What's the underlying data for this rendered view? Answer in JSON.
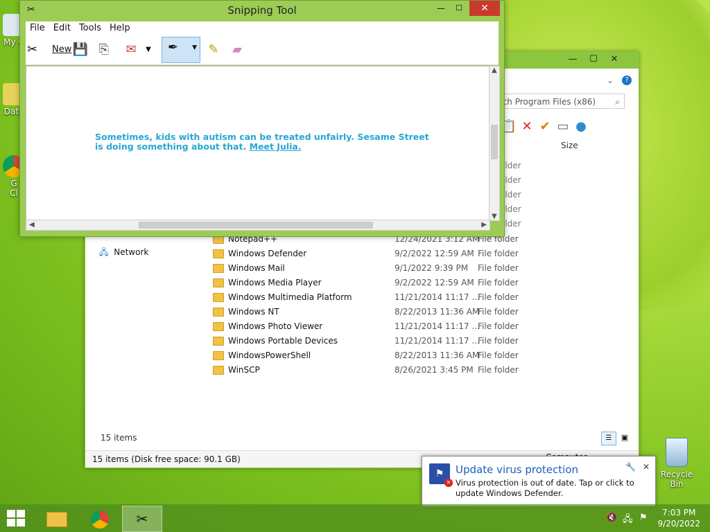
{
  "desktop": {
    "partial_icons": [
      "My C",
      "Data",
      "G",
      "Cl"
    ],
    "recycle_bin_label": "Recycle Bin"
  },
  "explorer": {
    "search_placeholder": "rch Program Files (x86)",
    "col_size": "Size",
    "partial_types": [
      "older",
      "older",
      "older",
      "older",
      "older"
    ],
    "network_label": "Network",
    "rows": [
      {
        "name": "Notepad++",
        "date": "12/24/2021 3:12 AM",
        "type": "File folder"
      },
      {
        "name": "Windows Defender",
        "date": "9/2/2022 12:59 AM",
        "type": "File folder"
      },
      {
        "name": "Windows Mail",
        "date": "9/1/2022 9:39 PM",
        "type": "File folder"
      },
      {
        "name": "Windows Media Player",
        "date": "9/2/2022 12:59 AM",
        "type": "File folder"
      },
      {
        "name": "Windows Multimedia Platform",
        "date": "11/21/2014 11:17 ...",
        "type": "File folder"
      },
      {
        "name": "Windows NT",
        "date": "8/22/2013 11:36 AM",
        "type": "File folder"
      },
      {
        "name": "Windows Photo Viewer",
        "date": "11/21/2014 11:17 ...",
        "type": "File folder"
      },
      {
        "name": "Windows Portable Devices",
        "date": "11/21/2014 11:17 ...",
        "type": "File folder"
      },
      {
        "name": "WindowsPowerShell",
        "date": "8/22/2013 11:36 AM",
        "type": "File folder"
      },
      {
        "name": "WinSCP",
        "date": "8/26/2021 3:45 PM",
        "type": "File folder"
      }
    ],
    "item_count": "15 items",
    "status_text": "15 items (Disk free space: 90.1 GB)",
    "status_computer": "Computer"
  },
  "snip": {
    "title": "Snipping Tool",
    "menu": [
      "File",
      "Edit",
      "Tools",
      "Help"
    ],
    "new_label": "New",
    "message_text": "Sometimes, kids with autism can be treated unfairly. Sesame Street is doing something about that.",
    "message_link": "Meet Julia."
  },
  "toast": {
    "title": "Update virus protection",
    "body": "Virus protection is out of date. Tap or click to update Windows Defender."
  },
  "taskbar": {
    "time": "7:03 PM",
    "date": "9/20/2022"
  }
}
